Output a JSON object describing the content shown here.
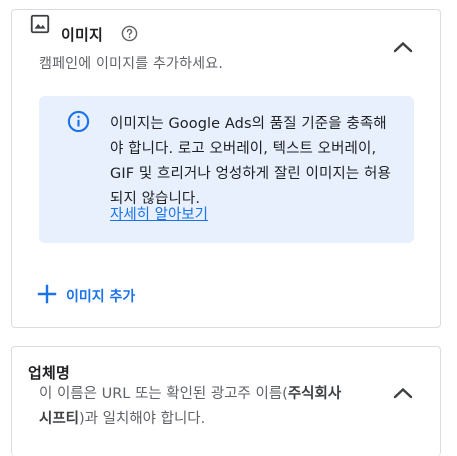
{
  "image_section": {
    "title": "이미지",
    "subtitle": "캠페인에 이미지를 추가하세요.",
    "info_text": "이미지는 Google Ads의 품질 기준을 충족해야 합니다. 로고 오버레이, 텍스트 오버레이, GIF 및 흐리거나 엉성하게 잘린 이미지는 허용되지 않습니다.",
    "info_link": "자세히 알아보기",
    "add_button": "이미지 추가",
    "icons": [
      "image-icon",
      "help-icon",
      "chevron-up-icon",
      "info-icon",
      "plus-icon"
    ]
  },
  "business_section": {
    "title": "업체명",
    "desc_prefix": "이 이름은 URL 또는 확인된 광고주 이름(",
    "desc_bold": "주식회사 시프티",
    "desc_suffix": ")과 일치해야 합니다."
  },
  "colors": {
    "accent": "#1a73e8",
    "info_bg": "#e8f0fe",
    "border": "#dadce0",
    "muted": "#5f6368"
  }
}
